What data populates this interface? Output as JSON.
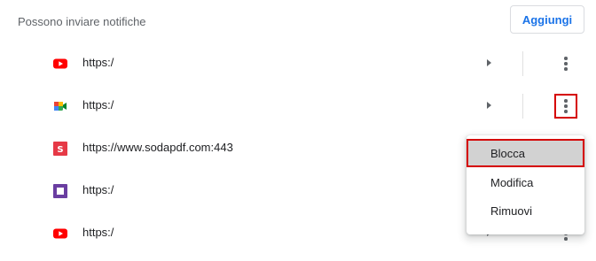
{
  "header": {
    "label": "Possono inviare notifiche",
    "add_button": "Aggiungi"
  },
  "sites": [
    {
      "url": "https:/",
      "icon": "youtube-icon"
    },
    {
      "url": "https:/",
      "icon": "google-meet-icon"
    },
    {
      "url": "https://www.sodapdf.com:443",
      "icon": "sodapdf-icon"
    },
    {
      "url": "https:/",
      "icon": "purple-square-icon"
    },
    {
      "url": "https:/",
      "icon": "youtube-icon"
    }
  ],
  "menu": {
    "items": [
      "Blocca",
      "Modifica",
      "Rimuovi"
    ]
  },
  "colors": {
    "accent": "#1a73e8",
    "highlight": "#d50000",
    "youtube": "#ff0000",
    "soda": "#e63946",
    "purple": "#6a3ea1"
  }
}
